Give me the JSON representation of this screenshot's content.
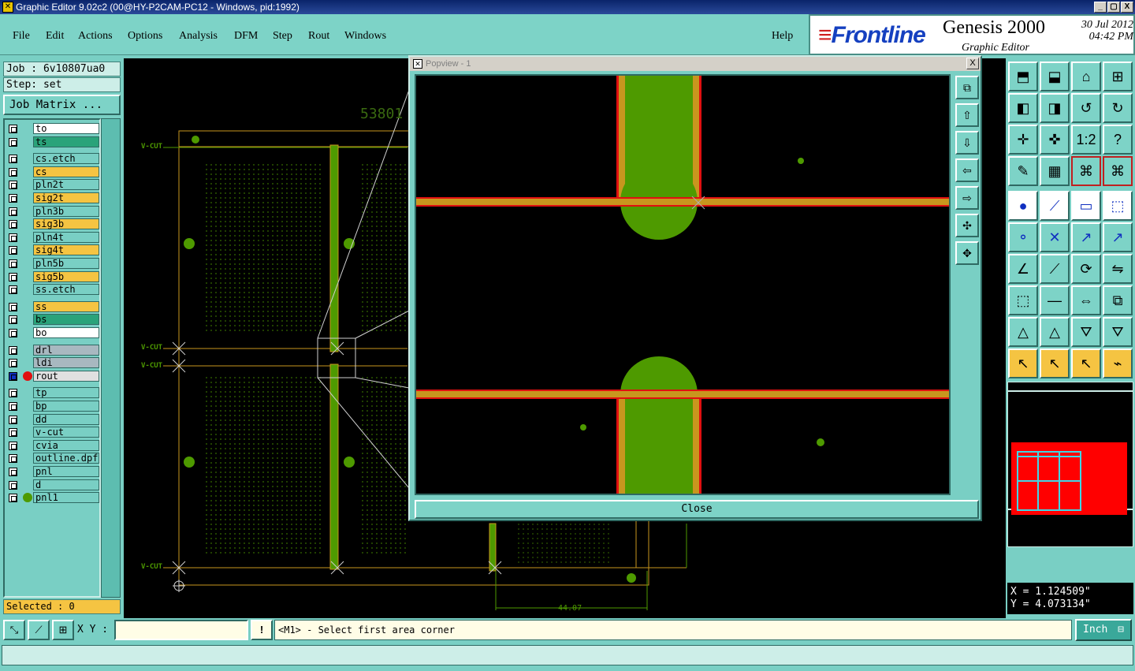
{
  "window": {
    "title": "Graphic Editor 9.02c2 (00@HY-P2CAM-PC12 - Windows, pid:1992)",
    "controls": [
      "_",
      "▢",
      "X"
    ]
  },
  "menu": {
    "items": [
      "File",
      "Edit",
      "Actions",
      "Options",
      "Analysis",
      "DFM",
      "Step",
      "Rout",
      "Windows"
    ],
    "help": "Help"
  },
  "brand": {
    "logo": "Frontline",
    "product": "Genesis 2000",
    "date": "30 Jul 2012",
    "time": "04:42 PM",
    "subtitle": "Graphic Editor"
  },
  "job": {
    "job_line": "Job : 6v10807ua0",
    "step_line": "Step: set",
    "matrix_button": "Job Matrix ..."
  },
  "layers": [
    {
      "name": "to",
      "color": "#ffffff",
      "group": 0
    },
    {
      "name": "ts",
      "color": "#2aa37a",
      "group": 0
    },
    {
      "name": "cs.etch",
      "color": "#79cfc4",
      "group": 1
    },
    {
      "name": "cs",
      "color": "#f5c442",
      "group": 1
    },
    {
      "name": "pln2t",
      "color": "#79cfc4",
      "group": 1
    },
    {
      "name": "sig2t",
      "color": "#f5c442",
      "group": 1
    },
    {
      "name": "pln3b",
      "color": "#79cfc4",
      "group": 1
    },
    {
      "name": "sig3b",
      "color": "#f5c442",
      "group": 1
    },
    {
      "name": "pln4t",
      "color": "#79cfc4",
      "group": 1
    },
    {
      "name": "sig4t",
      "color": "#f5c442",
      "group": 1
    },
    {
      "name": "pln5b",
      "color": "#79cfc4",
      "group": 1
    },
    {
      "name": "sig5b",
      "color": "#f5c442",
      "group": 1
    },
    {
      "name": "ss.etch",
      "color": "#79cfc4",
      "group": 1
    },
    {
      "name": "ss",
      "color": "#f5c442",
      "group": 2
    },
    {
      "name": "bs",
      "color": "#2aa37a",
      "group": 2
    },
    {
      "name": "bo",
      "color": "#ffffff",
      "group": 2
    },
    {
      "name": "drl",
      "color": "#a8b8c0",
      "group": 3
    },
    {
      "name": "ldi",
      "color": "#a8b8c0",
      "group": 3
    },
    {
      "name": "rout",
      "color": "#e0e0e0",
      "group": 3,
      "active": true
    },
    {
      "name": "tp",
      "color": "#79cfc4",
      "group": 4
    },
    {
      "name": "bp",
      "color": "#79cfc4",
      "group": 4
    },
    {
      "name": "dd",
      "color": "#79cfc4",
      "group": 4
    },
    {
      "name": "v-cut",
      "color": "#79cfc4",
      "group": 4
    },
    {
      "name": "cvia",
      "color": "#79cfc4",
      "group": 4
    },
    {
      "name": "outline.dpf",
      "color": "#79cfc4",
      "group": 4
    },
    {
      "name": "pnl",
      "color": "#79cfc4",
      "group": 4
    },
    {
      "name": "d",
      "color": "#79cfc4",
      "group": 4
    },
    {
      "name": "pnl1",
      "color": "#79cfc4",
      "group": 4,
      "work": true
    }
  ],
  "selected": "Selected : 0",
  "canvas": {
    "vcut_labels": [
      "V-CUT",
      "V-CUT",
      "V-CUT",
      "V-CUT"
    ],
    "dimension_top": "53801",
    "dimension_bottom": "44.07"
  },
  "popview": {
    "title": "Popview - 1",
    "close_button": "Close",
    "close_x": "X"
  },
  "coords": {
    "x": "X = 1.124509\"",
    "y": "Y = 4.073134\""
  },
  "bottom": {
    "xy_label": "X Y :",
    "xy_value": "",
    "prompt_text": "<M1> - Select first area corner",
    "units": "Inch",
    "alert_icon": "!"
  },
  "colors": {
    "panel": "#79cfc4",
    "copper": "#4e9a00",
    "layer_orange": "#c8961e",
    "rout_red": "#e01010",
    "minimap_red": "#ff0000",
    "minimap_grid": "#3fd6e6"
  }
}
